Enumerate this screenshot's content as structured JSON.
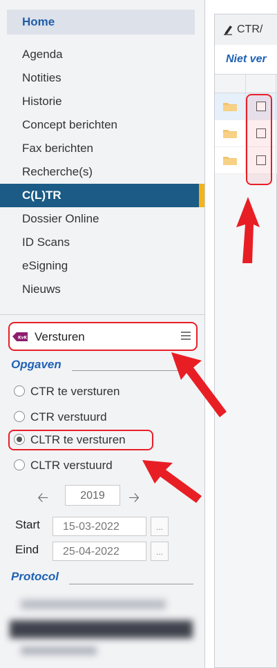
{
  "sidebar": {
    "home": "Home",
    "items": [
      "Agenda",
      "Notities",
      "Historie",
      "Concept berichten",
      "Fax berichten",
      "Recherche(s)",
      "C(L)TR",
      "Dossier Online",
      "ID Scans",
      "eSigning",
      "Nieuws"
    ],
    "active_item": "C(L)TR"
  },
  "versturen": {
    "label": "Versturen",
    "icon": "kvk-badge-icon"
  },
  "opgaven": {
    "title": "Opgaven",
    "options": [
      {
        "label": "CTR te versturen",
        "checked": false
      },
      {
        "label": "CTR verstuurd",
        "checked": false
      },
      {
        "label": "CLTR te versturen",
        "checked": true
      },
      {
        "label": "CLTR verstuurd",
        "checked": false
      }
    ]
  },
  "year": {
    "value": "2019",
    "prev_icon": "arrow-left-icon",
    "next_icon": "arrow-right-icon"
  },
  "dates": {
    "start_label": "Start",
    "start_value": "15-03-2022",
    "end_label": "Eind",
    "end_value": "25-04-2022",
    "picker_label": "..."
  },
  "protocol": {
    "title": "Protocol"
  },
  "main": {
    "tab_title": "CTR/",
    "tab_icon": "pen-icon",
    "subheader": "Niet ver"
  },
  "colors": {
    "accent_blue": "#1f62b5",
    "active_bg": "#1b5b86",
    "active_bar": "#f3b31b",
    "highlight_red": "#e81e25"
  }
}
